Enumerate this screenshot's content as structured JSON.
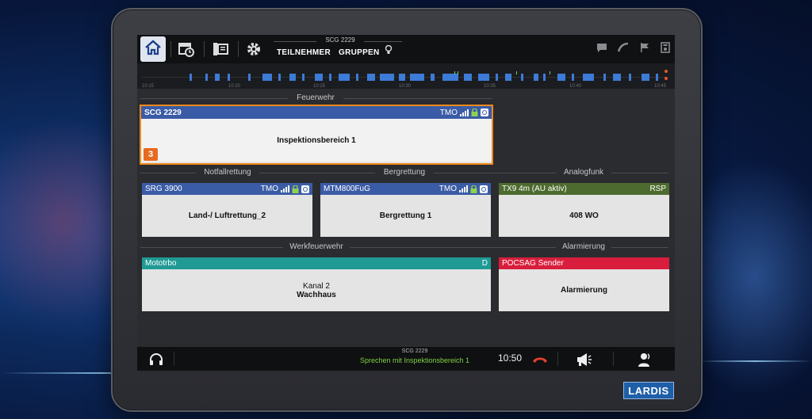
{
  "topbar": {
    "group_title": "SCG 2229",
    "tabs": [
      "TEILNEHMER",
      "GRUPPEN"
    ],
    "icons_left": [
      "home-icon",
      "calendar-clock-icon",
      "contacts-icon",
      "gear-icon"
    ],
    "icons_right": [
      "message-icon",
      "phone-icon",
      "flag-icon",
      "device-icon"
    ]
  },
  "timeline": {
    "labels": [
      "10:15",
      "10:20",
      "10:25",
      "10:30",
      "10:35",
      "10:40",
      "10:45"
    ]
  },
  "sections": {
    "feuerwehr": "Feuerwehr",
    "notfallrettung": "Notfallrettung",
    "bergrettung": "Bergrettung",
    "analogfunk": "Analogfunk",
    "werkfeuerwehr": "Werkfeuerwehr",
    "alarmierung": "Alarmierung"
  },
  "cards": {
    "scg": {
      "name": "SCG 2229",
      "type": "TMO",
      "body": "Inspektionsbereich 1",
      "badge": "3",
      "head_color": "#3a5ba6"
    },
    "srg": {
      "name": "SRG 3900",
      "type": "TMO",
      "body": "Land-/ Luftrettung_2",
      "head_color": "#3a5ba6"
    },
    "mtm": {
      "name": "MTM800FuG",
      "type": "TMO",
      "body": "Bergrettung 1",
      "head_color": "#3a5ba6"
    },
    "tx9": {
      "name": "TX9 4m (AU aktiv)",
      "type": "RSP",
      "body": "408 WO",
      "head_color": "#4d6b2e"
    },
    "mototrbo": {
      "name": "Mototrbo",
      "type": "D",
      "body_line1": "Kanal 2",
      "body_line2": "Wachhaus",
      "head_color": "#1f9a95"
    },
    "pocsag": {
      "name": "POCSAG Sender",
      "body": "Alarmierung",
      "head_color": "#d81e3c"
    }
  },
  "bottombar": {
    "group": "SCG 2229",
    "status": "Sprechen mit Inspektionsbereich 1",
    "time": "10:50",
    "icons": [
      "headset-icon",
      "hangup-icon",
      "megaphone-icon",
      "person-speaking-icon"
    ]
  },
  "brand": "LARDIS"
}
